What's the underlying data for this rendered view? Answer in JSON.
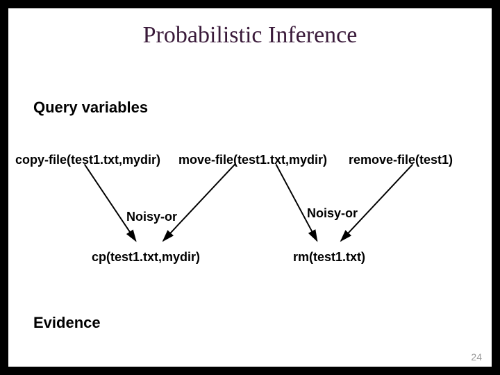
{
  "title": "Probabilistic Inference",
  "sections": {
    "query": "Query variables",
    "evidence": "Evidence"
  },
  "nodes": {
    "copy": "copy-file(test1.txt,mydir)",
    "move": "move-file(test1.txt,mydir)",
    "remove": "remove-file(test1)",
    "noisy1": "Noisy-or",
    "noisy2": "Noisy-or",
    "cp": "cp(test1.txt,mydir)",
    "rm": "rm(test1.txt)"
  },
  "page_number": "24"
}
